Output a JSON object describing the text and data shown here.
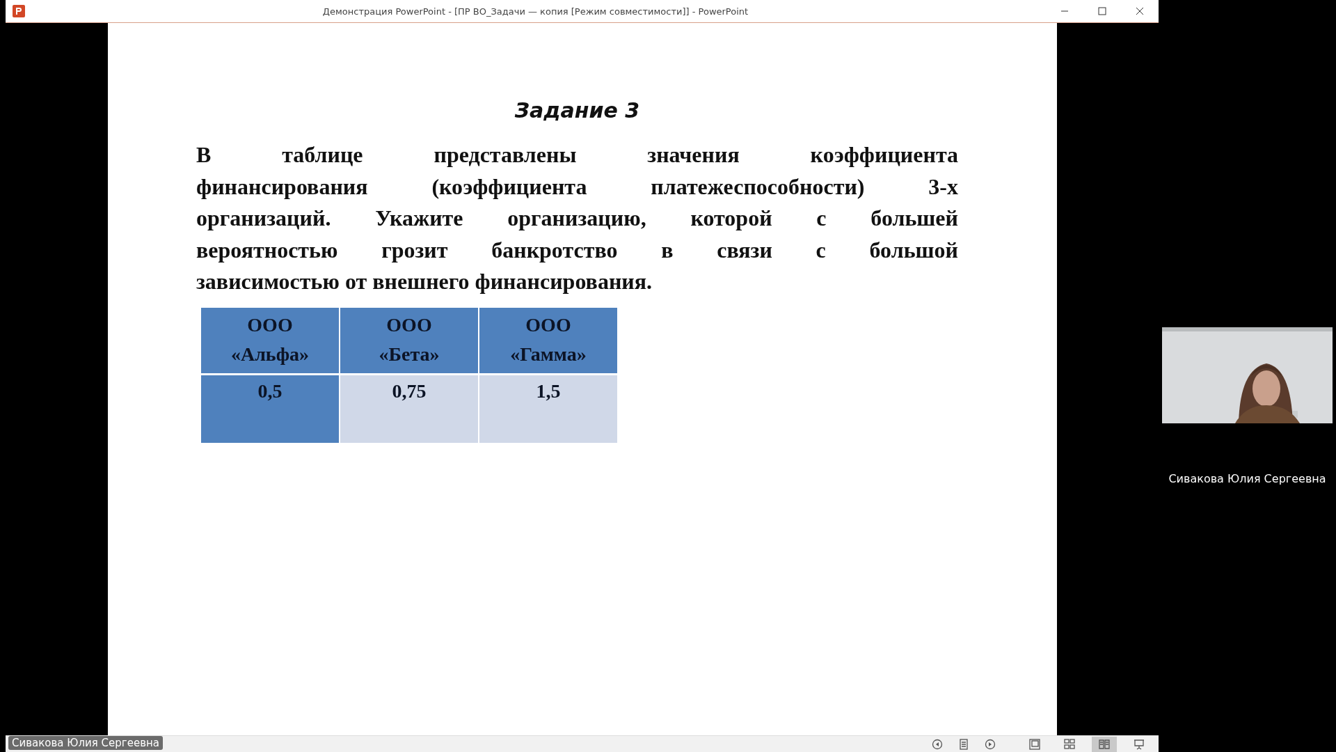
{
  "window": {
    "title": "Демонстрация PowerPoint - [ПР ВО_Задачи  — копия [Режим совместимости]] - PowerPoint"
  },
  "slide": {
    "title": "Задание 3",
    "text_lines": [
      "В таблице представлены значения коэффициента",
      "финансирования (коэффициента платежеспособности) 3-х",
      "организаций. Укажите организацию, которой с большей",
      "вероятностью грозит банкротство в связи с большой",
      "зависимостью от внешнего финансирования."
    ],
    "table": {
      "columns": [
        {
          "label": "ООО «Альфа»"
        },
        {
          "label": "ООО «Бета»"
        },
        {
          "label": "ООО «Гамма»"
        }
      ],
      "cells": [
        {
          "text": "0,5",
          "selected": true
        },
        {
          "text": "0,75",
          "selected": false
        },
        {
          "text": "1,5",
          "selected": false
        }
      ]
    }
  },
  "status_bar": {
    "views": [
      {
        "kind": "normal",
        "selected": false
      },
      {
        "kind": "sorter",
        "selected": false
      },
      {
        "kind": "reading",
        "selected": true
      },
      {
        "kind": "show",
        "selected": false
      }
    ]
  },
  "presenter_label": "Сивакова Юлия Сергеевна",
  "video": {
    "name": "Сивакова Юлия Сергеевна"
  }
}
